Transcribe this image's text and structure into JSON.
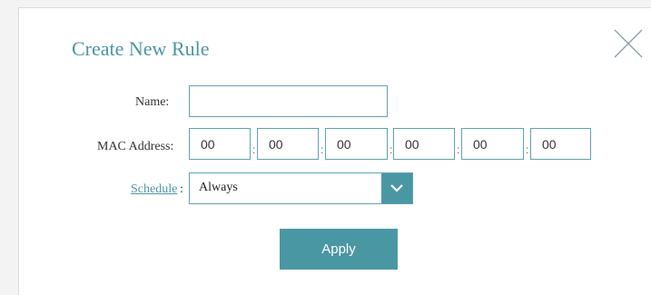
{
  "dialog": {
    "title": "Create New Rule",
    "close_icon": "close-icon"
  },
  "form": {
    "name_label": "Name:",
    "name_value": "",
    "mac_label": "MAC Address:",
    "mac_octets": [
      "00",
      "00",
      "00",
      "00",
      "00",
      "00"
    ],
    "mac_separator": ":",
    "schedule_label": "Schedule",
    "schedule_colon": ":",
    "schedule_value": "Always",
    "schedule_dropdown_icon": "chevron-down-icon"
  },
  "actions": {
    "apply_label": "Apply"
  },
  "colors": {
    "accent": "#4a97a4",
    "title": "#4c95a3",
    "input_border": "#5fa3b0"
  }
}
